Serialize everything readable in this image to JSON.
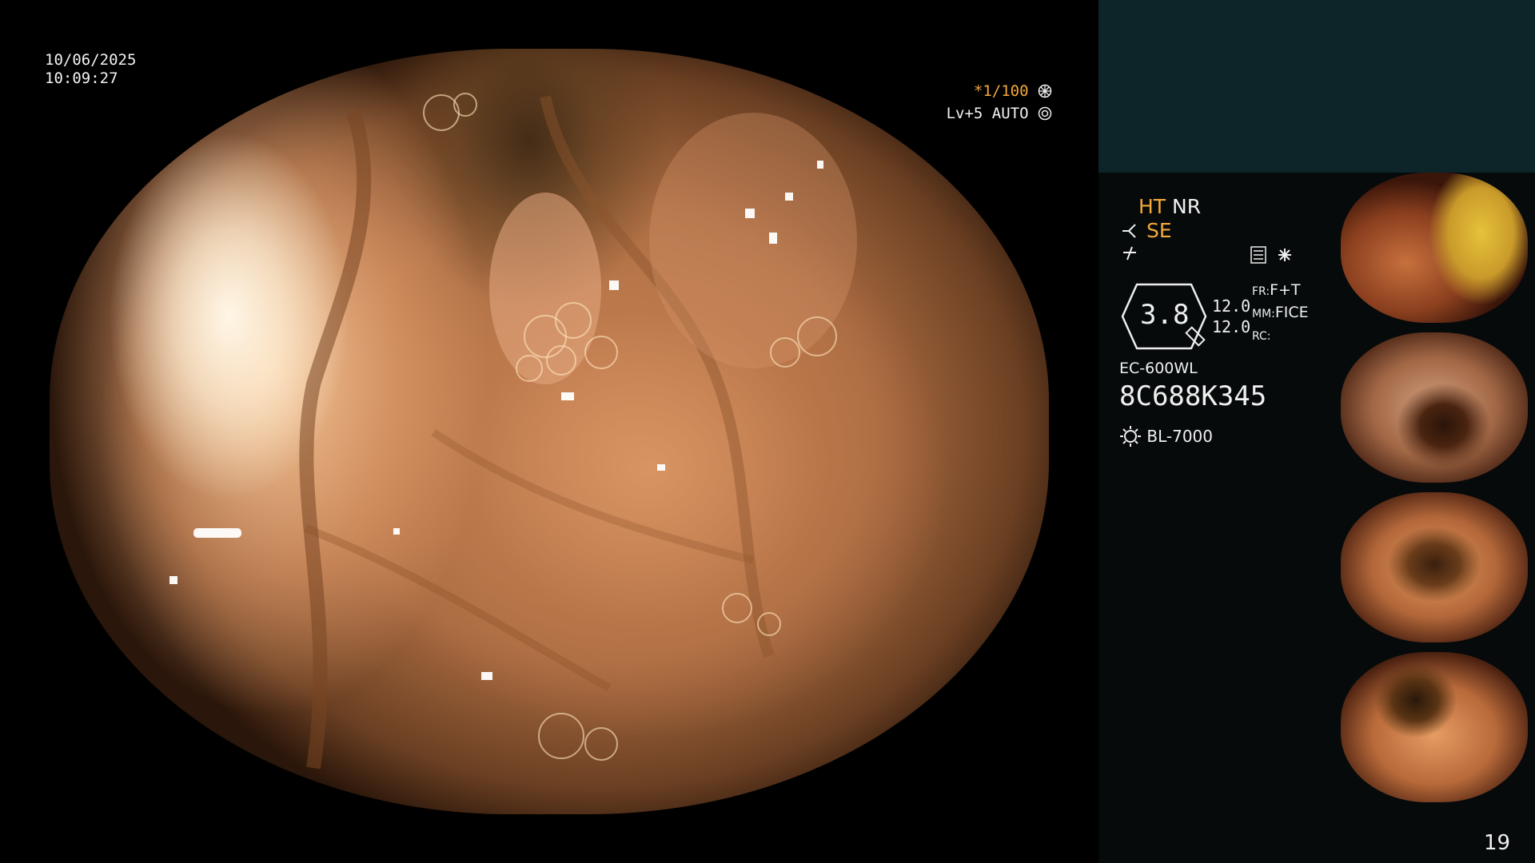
{
  "overlay": {
    "date": "10/06/2025",
    "time": "10:09:27",
    "shutter": "*1/100",
    "level": "Lv+5 AUTO"
  },
  "panel": {
    "mode_ht": "HT",
    "mode_nr": "NR",
    "mode_se": "SE",
    "magnification": "3.8",
    "val_1": "12.0",
    "val_2": "12.0",
    "fr_label": "FR:",
    "fr_value": "F+T",
    "mm_label": "MM:",
    "mm_value": "FICE",
    "rc_label": "RC:",
    "scope_model": "EC-600WL",
    "serial": "8C688K345",
    "light_source": "BL-7000",
    "page_number": "19"
  },
  "icons": [
    "asterisk-wheel-icon",
    "auto-iris-icon",
    "fork-icon",
    "slash-icon",
    "settings-list-icon",
    "star-icon",
    "lamp-icon",
    "scope-icon"
  ],
  "colors": {
    "accent_orange": "#f3a83a",
    "panel_band": "#0d2428",
    "panel_bg": "#060a0a"
  }
}
